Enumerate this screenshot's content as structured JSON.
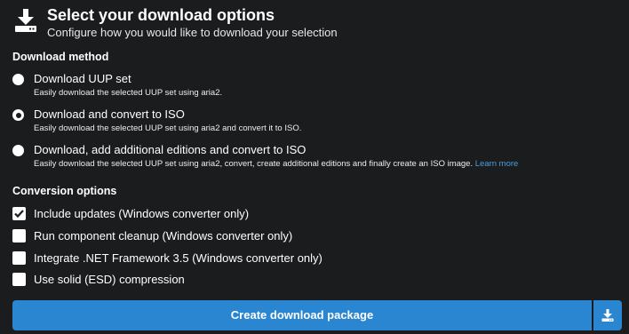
{
  "header": {
    "icon": "download-icon",
    "title": "Select your download options",
    "subtitle": "Configure how you would like to download your selection"
  },
  "download_method": {
    "heading": "Download method",
    "selected": "Download and convert to ISO",
    "options": [
      {
        "label": "Download UUP set",
        "description": "Easily download the selected UUP set using aria2.",
        "checked": false
      },
      {
        "label": "Download and convert to ISO",
        "description": "Easily download the selected UUP set using aria2 and convert it to ISO.",
        "checked": true
      },
      {
        "label": "Download, add additional editions and convert to ISO",
        "description": "Easily download the selected UUP set using aria2, convert, create additional editions and finally create an ISO image.",
        "link": "Learn more",
        "checked": false
      }
    ]
  },
  "conversion_options": {
    "heading": "Conversion options",
    "items": [
      {
        "label": "Include updates (Windows converter only)",
        "checked": true
      },
      {
        "label": "Run component cleanup (Windows converter only)",
        "checked": false
      },
      {
        "label": "Integrate .NET Framework 3.5 (Windows converter only)",
        "checked": false
      },
      {
        "label": "Use solid (ESD) compression",
        "checked": false
      }
    ]
  },
  "action": {
    "create_label": "Create download package",
    "side_icon": "download-icon"
  },
  "colors": {
    "background": "#1b1c1d",
    "accent": "#2a86d1",
    "link": "#4a9fe0"
  }
}
